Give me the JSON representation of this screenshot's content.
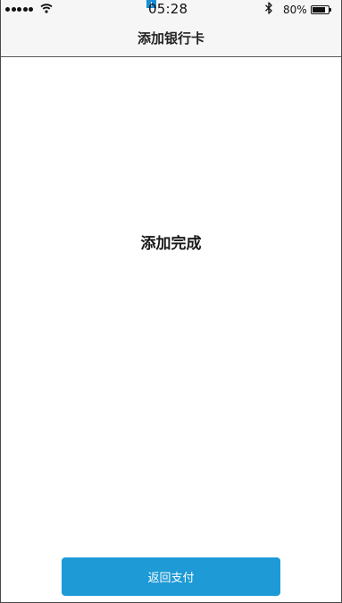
{
  "status_bar": {
    "time": "05:28",
    "battery_percent_label": "80%",
    "battery_level": 0.8,
    "signal_dots": 5
  },
  "nav": {
    "title": "添加银行卡"
  },
  "main": {
    "message": "添加完成"
  },
  "actions": {
    "return_label": "返回支付"
  },
  "colors": {
    "accent": "#1e9ad6",
    "header_bg": "#f6f6f6",
    "text": "#1a1a1a"
  },
  "icons": [
    "signal-dots-icon",
    "wifi-icon",
    "bluetooth-icon",
    "battery-icon"
  ]
}
